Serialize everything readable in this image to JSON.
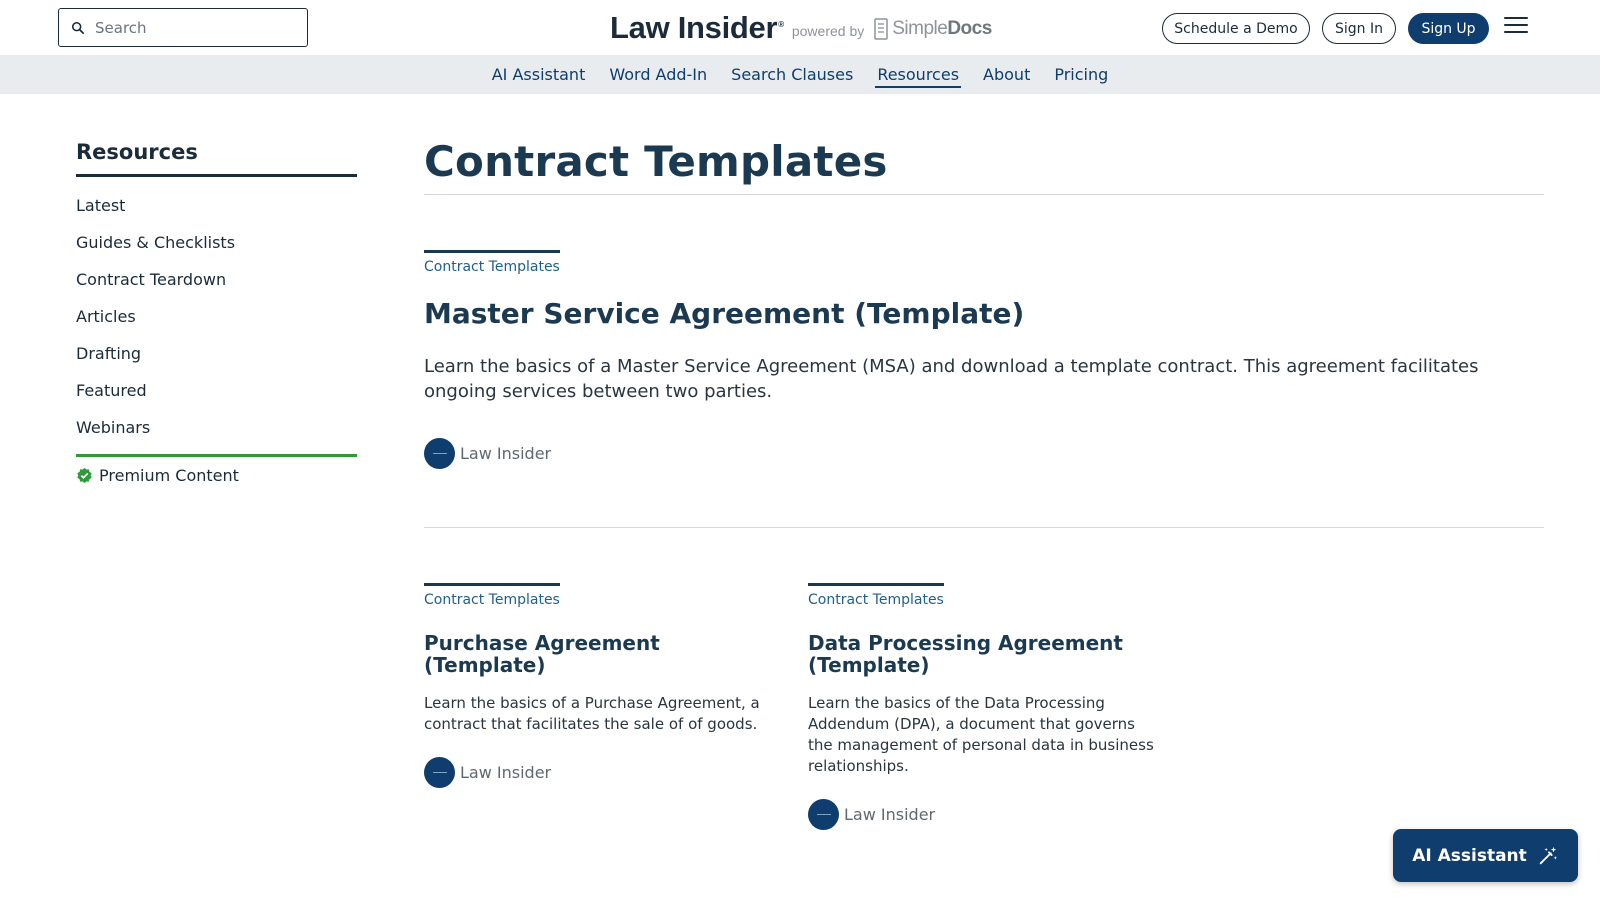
{
  "header": {
    "search_placeholder": "Search",
    "brand_name": "Law Insider",
    "brand_reg": "®",
    "powered_by": "powered by",
    "simpledocs_simple": "Simple",
    "simpledocs_docs": "Docs",
    "schedule_demo": "Schedule a Demo",
    "sign_in": "Sign In",
    "sign_up": "Sign Up"
  },
  "nav": {
    "items": [
      "AI Assistant",
      "Word Add-In",
      "Search Clauses",
      "Resources",
      "About",
      "Pricing"
    ],
    "active": "Resources"
  },
  "sidebar": {
    "title": "Resources",
    "items": [
      "Latest",
      "Guides & Checklists",
      "Contract Teardown",
      "Articles",
      "Drafting",
      "Featured",
      "Webinars"
    ],
    "premium": "Premium Content"
  },
  "main": {
    "title": "Contract Templates",
    "featured": {
      "tag": "Contract Templates",
      "title": "Master Service Agreement (Template)",
      "description": "Learn the basics of a Master Service Agreement (MSA) and download a template contract. This agreement facilitates ongoing services between two parties.",
      "author": "Law Insider"
    },
    "cards": [
      {
        "tag": "Contract Templates",
        "title": "Purchase Agreement (Template)",
        "description": "Learn the basics of a Purchase Agreement, a contract that facilitates the sale of of goods.",
        "author": "Law Insider"
      },
      {
        "tag": "Contract Templates",
        "title": "Data Processing Agreement (Template)",
        "description": "Learn the basics of the Data Processing Addendum (DPA), a document that governs the management of personal data in business relationships.",
        "author": "Law Insider"
      }
    ]
  },
  "ai_button": {
    "label": "AI Assistant",
    "icon": "magic-wand-icon"
  },
  "colors": {
    "navy": "#0e3d6e",
    "heading": "#1b3a52",
    "premium_green": "#2e9a3a",
    "navbar_bg": "#e9ecef"
  }
}
